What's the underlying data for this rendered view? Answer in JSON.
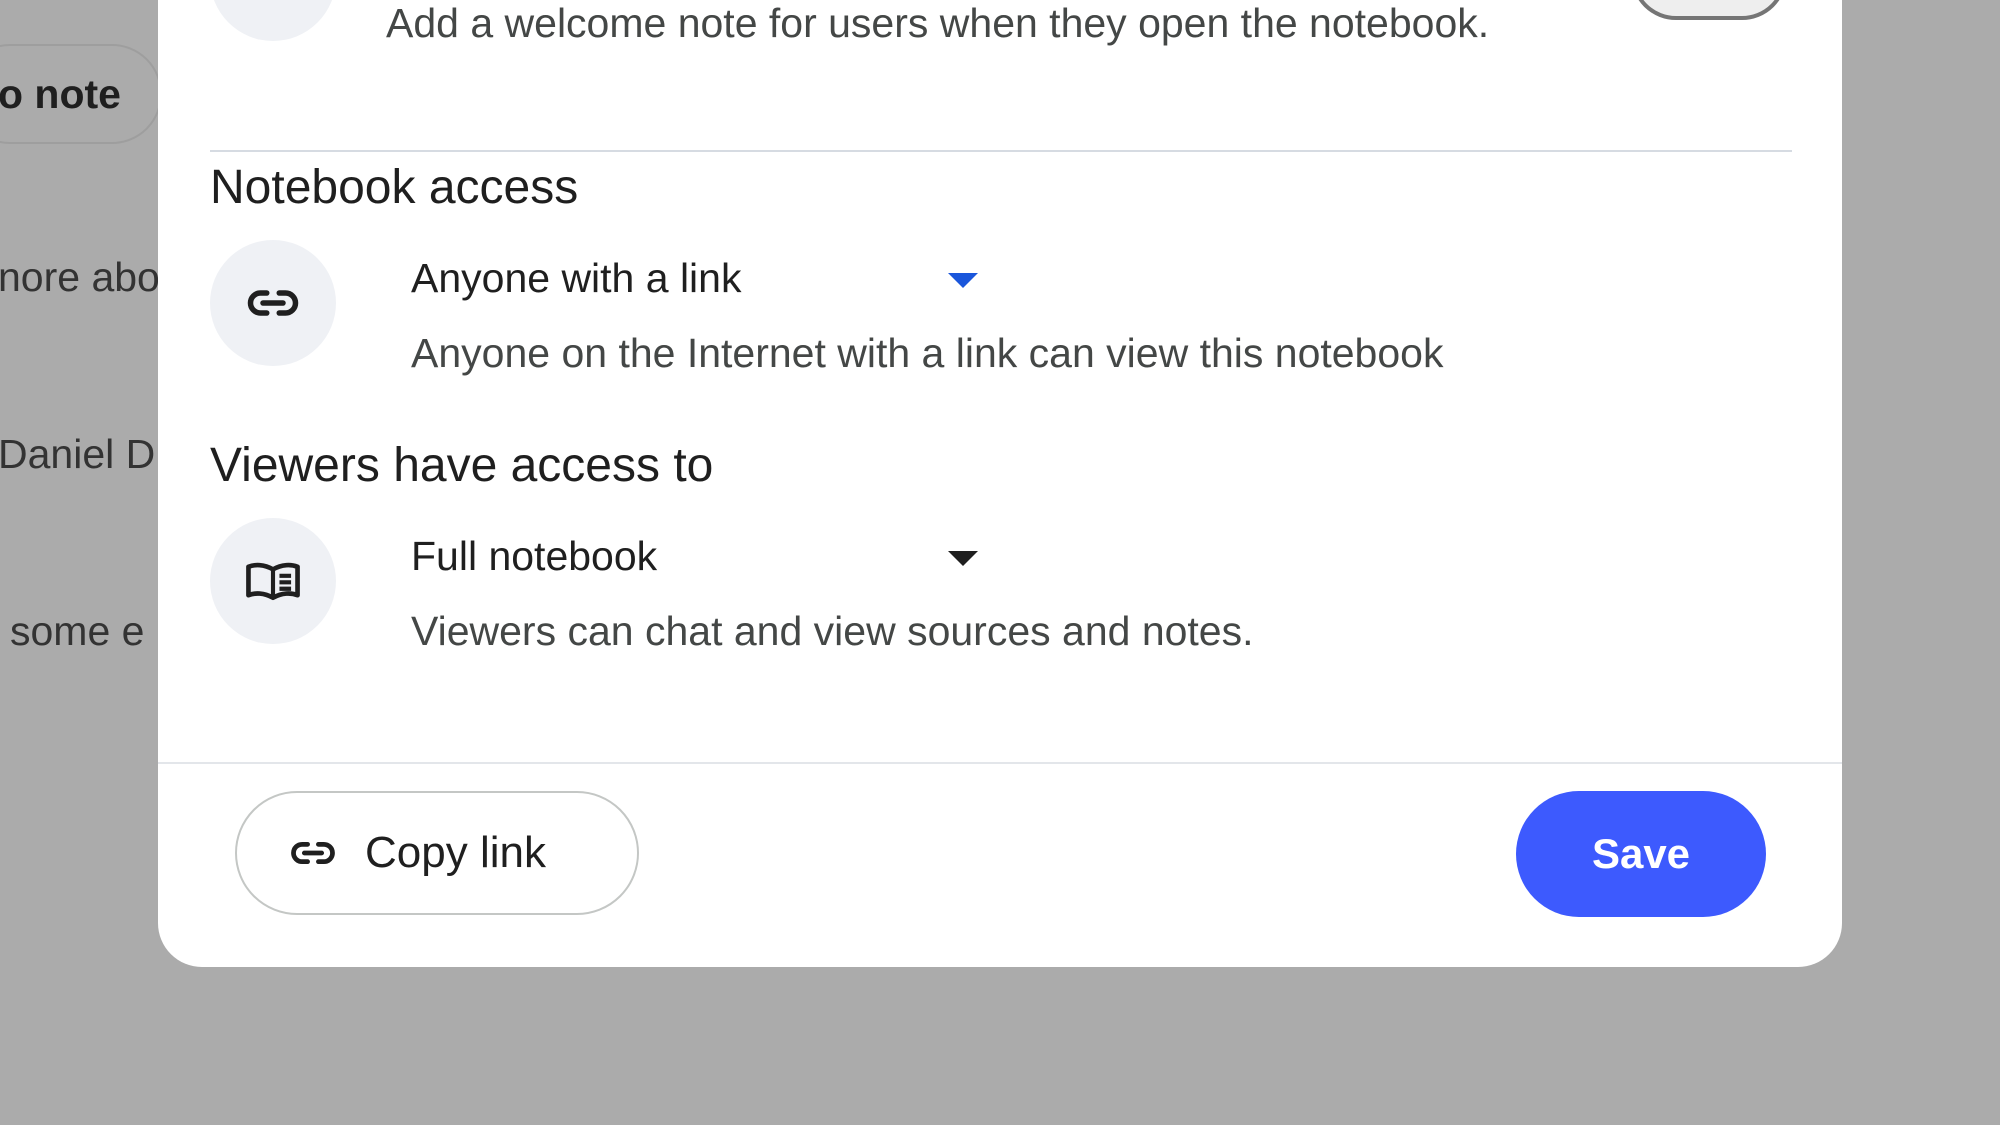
{
  "background": {
    "chip_label": "o note",
    "fragments": [
      "nore abo",
      "Daniel D",
      "some e"
    ]
  },
  "dialog": {
    "welcome_description": "Add a welcome note for users when they open the notebook.",
    "notebook_access": {
      "title": "Notebook access",
      "selected": "Anyone with a link",
      "description": "Anyone on the Internet with a link can view this notebook",
      "icon": "link-icon",
      "arrow_color": "#1a56db"
    },
    "viewers_access": {
      "title": "Viewers have access to",
      "selected": "Full notebook",
      "description": "Viewers can chat and view sources and notes.",
      "icon": "book-icon",
      "arrow_color": "#1f1f1f"
    },
    "footer": {
      "copy_link_label": "Copy link",
      "save_label": "Save"
    }
  },
  "colors": {
    "accent": "#3d5afe",
    "overlay": "#ababab"
  }
}
